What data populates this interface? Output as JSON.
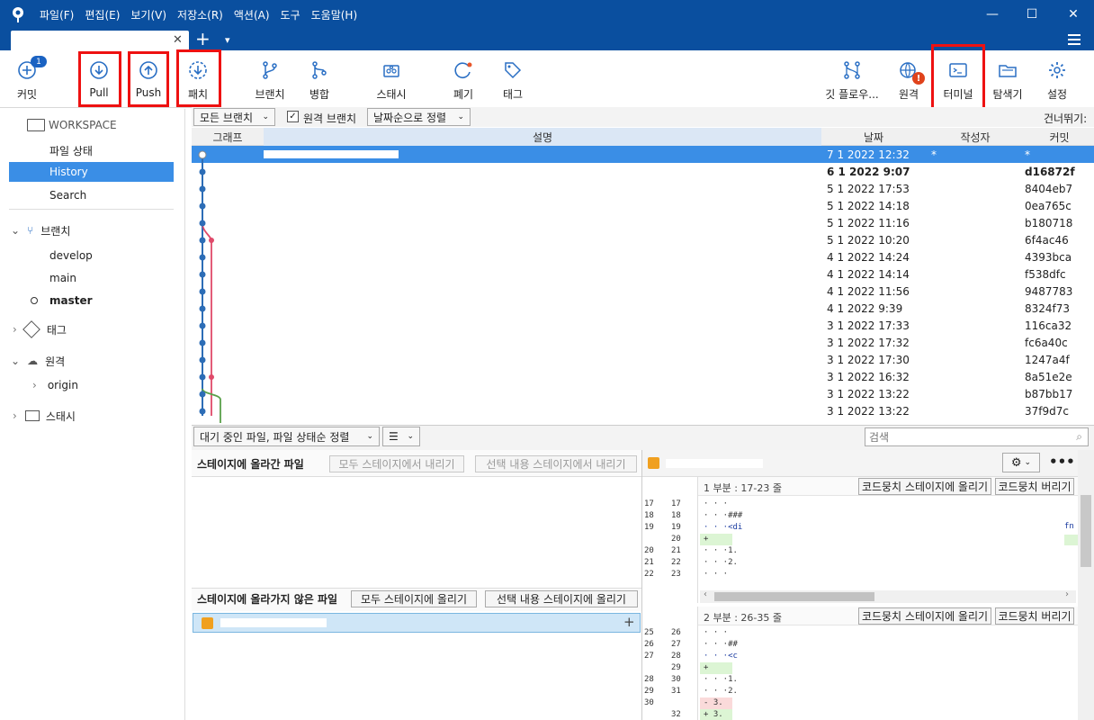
{
  "menu": [
    "파일(F)",
    "편집(E)",
    "보기(V)",
    "저장소(R)",
    "액션(A)",
    "도구",
    "도움말(H)"
  ],
  "window_controls": {
    "minimize": "—",
    "maximize": "☐",
    "close": "✕"
  },
  "tabs": {
    "add": "+",
    "more": "▾",
    "close": "✕"
  },
  "toolbar": {
    "commit": "커밋",
    "commit_badge": "1",
    "pull": "Pull",
    "push": "Push",
    "fetch": "패치",
    "branch": "브랜치",
    "merge": "병합",
    "stash": "스태시",
    "discard": "폐기",
    "tag": "태그",
    "gitflow": "깃 플로우...",
    "remote": "원격",
    "terminal": "터미널",
    "explorer": "탐색기",
    "settings": "설정"
  },
  "sidebar": {
    "workspace": "WORKSPACE",
    "workspace_items": [
      "파일 상태",
      "History",
      "Search"
    ],
    "branches": "브랜치",
    "branch_items": [
      "develop",
      "main",
      "master"
    ],
    "tags": "태그",
    "remotes": "원격",
    "remote_items": [
      "origin"
    ],
    "stashes": "스태시"
  },
  "history": {
    "branch_filter": "모든 브랜치",
    "remote_branch_label": "원격 브랜치",
    "sort": "날짜순으로 정렬",
    "skip": "건너뛰기:",
    "columns": [
      "그래프",
      "설명",
      "날짜",
      "작성자",
      "커밋"
    ],
    "rows": [
      {
        "date": "7 1 2022 12:32",
        "author": "*",
        "commit": "*"
      },
      {
        "date": "6 1 2022 9:07",
        "author": "",
        "commit": "d16872f"
      },
      {
        "date": "5 1 2022 17:53",
        "author": "",
        "commit": "8404eb7"
      },
      {
        "date": "5 1 2022 14:18",
        "author": "",
        "commit": "0ea765c"
      },
      {
        "date": "5 1 2022 11:16",
        "author": "",
        "commit": "b180718"
      },
      {
        "date": "5 1 2022 10:20",
        "author": "",
        "commit": "6f4ac46"
      },
      {
        "date": "4 1 2022 14:24",
        "author": "",
        "commit": "4393bca"
      },
      {
        "date": "4 1 2022 14:14",
        "author": "",
        "commit": "f538dfc"
      },
      {
        "date": "4 1 2022 11:56",
        "author": "",
        "commit": "9487783"
      },
      {
        "date": "4 1 2022 9:39",
        "author": "",
        "commit": "8324f73"
      },
      {
        "date": "3 1 2022 17:33",
        "author": "",
        "commit": "116ca32"
      },
      {
        "date": "3 1 2022 17:32",
        "author": "",
        "commit": "fc6a40c"
      },
      {
        "date": "3 1 2022 17:30",
        "author": "",
        "commit": "1247a4f"
      },
      {
        "date": "3 1 2022 16:32",
        "author": "",
        "commit": "8a51e2e"
      },
      {
        "date": "3 1 2022 13:22",
        "author": "",
        "commit": "b87bb17"
      },
      {
        "date": "3 1 2022 13:22",
        "author": "",
        "commit": "37f9d7c"
      }
    ]
  },
  "lower": {
    "file_sort": "대기 중인 파일, 파일 상태순 정렬",
    "search_placeholder": "검색",
    "staged_title": "스테이지에 올라간 파일",
    "unstage_all": "모두 스테이지에서 내리기",
    "unstage_selected": "선택 내용 스테이지에서 내리기",
    "unstaged_title": "스테이지에 올라가지 않은 파일",
    "stage_all": "모두 스테이지에 올리기",
    "stage_selected": "선택 내용 스테이지에 올리기"
  },
  "diff": {
    "hunk1_title": "1 부분 : 17-23 줄",
    "hunk2_title": "2 부분 : 26-35 줄",
    "stage_hunk": "코드뭉치 스테이지에 올리기",
    "discard_hunk": "코드뭉치 버리기",
    "hunk1_lines": [
      {
        "o": "17",
        "n": "17",
        "t": "· · ·"
      },
      {
        "o": "18",
        "n": "18",
        "t": "· · ·###"
      },
      {
        "o": "19",
        "n": "19",
        "t": "· · ·<di"
      },
      {
        "o": "",
        "n": "20",
        "t": "+"
      },
      {
        "o": "20",
        "n": "21",
        "t": "· · ·1."
      },
      {
        "o": "21",
        "n": "22",
        "t": "· · ·2."
      },
      {
        "o": "22",
        "n": "23",
        "t": "· · ·"
      }
    ],
    "hunk2_lines": [
      {
        "o": "25",
        "n": "26",
        "t": "· · ·"
      },
      {
        "o": "26",
        "n": "27",
        "t": "· · ·##"
      },
      {
        "o": "27",
        "n": "28",
        "t": "· · ·<c"
      },
      {
        "o": "",
        "n": "29",
        "t": "+"
      },
      {
        "o": "28",
        "n": "30",
        "t": "· · ·1."
      },
      {
        "o": "29",
        "n": "31",
        "t": "· · ·2."
      },
      {
        "o": "30",
        "n": "",
        "t": "- 3."
      },
      {
        "o": "",
        "n": "32",
        "t": "+ 3."
      }
    ]
  }
}
